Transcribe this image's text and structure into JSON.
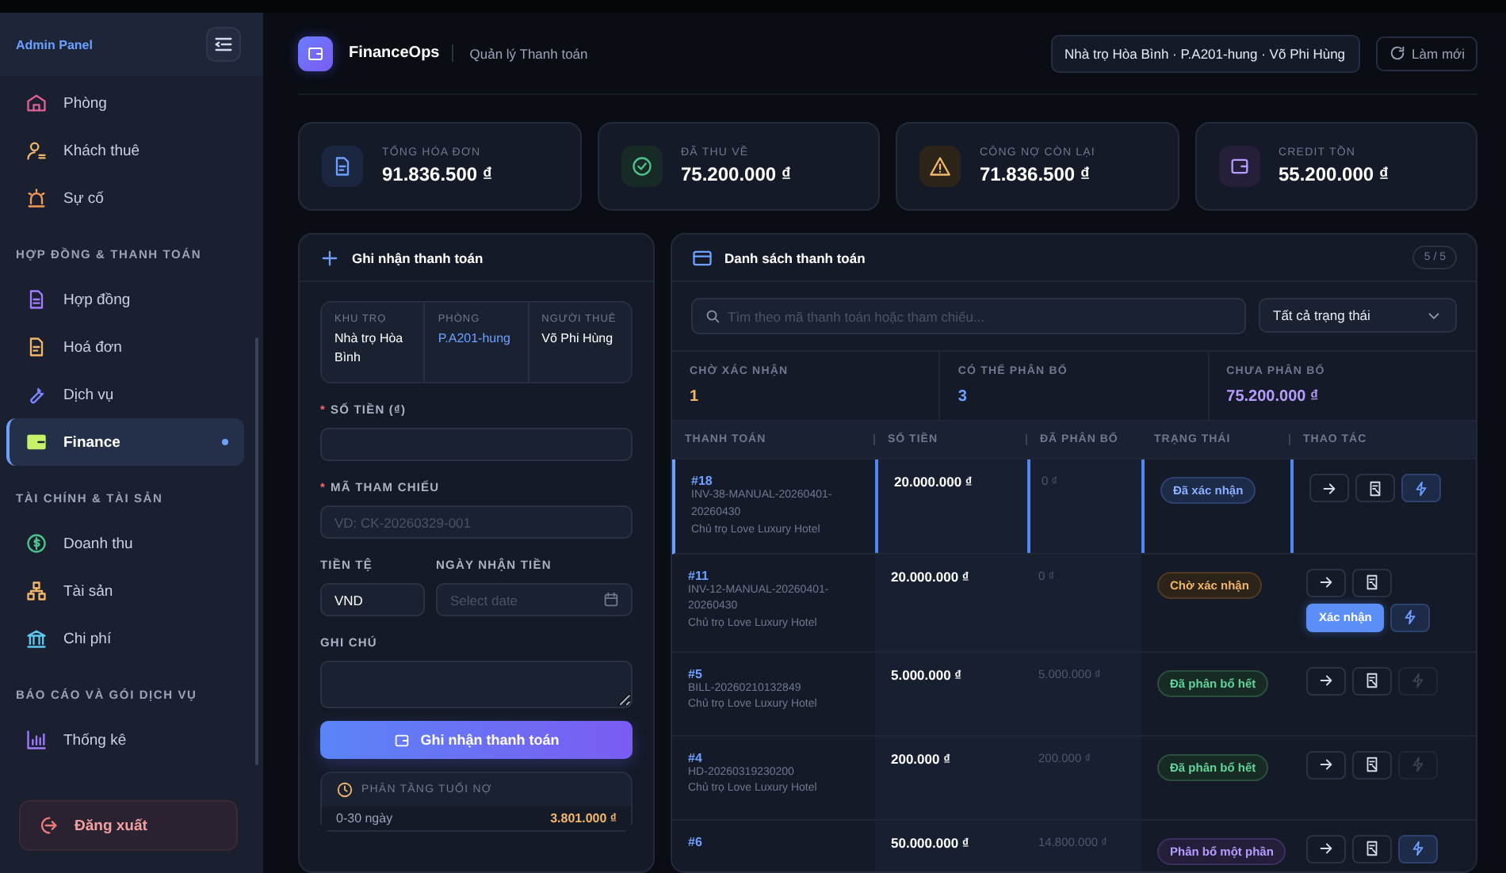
{
  "sidebar": {
    "title": "Admin Panel",
    "sections": [
      {
        "items": [
          {
            "label": "Phòng",
            "selected": false
          },
          {
            "label": "Khách thuê",
            "selected": false
          },
          {
            "label": "Sự cố",
            "selected": false
          }
        ]
      },
      {
        "heading": "HỢP ĐỒNG & THANH TOÁN",
        "items": [
          {
            "label": "Hợp đồng",
            "selected": false
          },
          {
            "label": "Hoá đơn",
            "selected": false
          },
          {
            "label": "Dịch vụ",
            "selected": false
          },
          {
            "label": "Finance",
            "selected": true
          }
        ]
      },
      {
        "heading": "TÀI CHÍNH & TÀI SẢN",
        "items": [
          {
            "label": "Doanh thu",
            "selected": false
          },
          {
            "label": "Tài sản",
            "selected": false
          },
          {
            "label": "Chi phí",
            "selected": false
          }
        ]
      },
      {
        "heading": "BÁO CÁO VÀ GÓI DỊCH VỤ",
        "items": [
          {
            "label": "Thống kê",
            "selected": false
          }
        ]
      }
    ],
    "logout": "Đăng xuất"
  },
  "header": {
    "app": "FinanceOps",
    "subtitle": "Quản lý Thanh toán",
    "context": "Nhà trọ Hòa Bình · P.A201-hung · Võ Phi Hùng",
    "refresh": "Làm mới"
  },
  "stats": [
    {
      "label": "TỔNG HÓA ĐƠN",
      "value": "91.836.500 ₫"
    },
    {
      "label": "ĐÃ THU VỀ",
      "value": "75.200.000 ₫"
    },
    {
      "label": "CÔNG NỢ CÒN LẠI",
      "value": "71.836.500 ₫"
    },
    {
      "label": "CREDIT TỒN",
      "value": "55.200.000 ₫"
    }
  ],
  "form": {
    "title": "Ghi nhận thanh toán",
    "info": [
      {
        "label": "KHU TRỌ",
        "value": "Nhà trọ Hòa Bình",
        "link": false
      },
      {
        "label": "PHÒNG",
        "value": "P.A201-hung",
        "link": true
      },
      {
        "label": "NGƯỜI THUÊ",
        "value": "Võ Phi Hùng",
        "link": false
      }
    ],
    "amount": {
      "label": "SỐ TIỀN (₫)",
      "required_mark": "*"
    },
    "reference": {
      "label": "MÃ THAM CHIẾU",
      "required_mark": "*",
      "placeholder": "VD: CK-20260329-001"
    },
    "currency": {
      "label": "TIỀN TỆ",
      "value": "VND"
    },
    "date": {
      "label": "NGÀY NHẬN TIỀN",
      "placeholder": "Select date"
    },
    "note": {
      "label": "GHI CHÚ"
    },
    "submit": "Ghi nhận thanh toán",
    "aging": {
      "title": "PHÂN TẦNG TUỔI NỢ",
      "rows": [
        {
          "label": "0-30 ngày",
          "value": "3.801.000 ₫"
        }
      ]
    }
  },
  "list": {
    "title": "Danh sách thanh toán",
    "count": "5 / 5",
    "search": {
      "placeholder": "Tìm theo mã thanh toán hoặc tham chiếu..."
    },
    "filter": "Tất cả trạng thái",
    "summary": [
      {
        "label": "CHỜ XÁC NHẬN",
        "value": "1",
        "color": "#f2b66a"
      },
      {
        "label": "CÓ THỂ PHÂN BỔ",
        "value": "3",
        "color": "#6ea0ff"
      },
      {
        "label": "CHƯA PHÂN BỔ",
        "value": "75.200.000 ₫",
        "color": "#b69cff"
      }
    ],
    "columns": [
      "THANH TOÁN",
      "SỐ TIỀN",
      "ĐÃ PHÂN BỔ",
      "TRẠNG THÁI",
      "THAO TÁC"
    ],
    "rows": [
      {
        "id": "#18",
        "code": "INV-38-MANUAL-20260401-20260430",
        "owner": "Chủ trọ Love Luxury Hotel",
        "amount": "20.000.000 ₫",
        "allocated": "0 ₫",
        "status": {
          "label": "Đã xác nhận",
          "kind": "confirmed"
        },
        "confirm": null,
        "allocate_enabled": true,
        "selected": true
      },
      {
        "id": "#11",
        "code": "INV-12-MANUAL-20260401-20260430",
        "owner": "Chủ trọ Love Luxury Hotel",
        "amount": "20.000.000 ₫",
        "allocated": "0 ₫",
        "status": {
          "label": "Chờ xác nhận",
          "kind": "pending"
        },
        "confirm": "Xác nhận",
        "allocate_enabled": true,
        "selected": false
      },
      {
        "id": "#5",
        "code": "BILL-20260210132849",
        "owner": "Chủ trọ Love Luxury Hotel",
        "amount": "5.000.000 ₫",
        "allocated": "5.000.000 ₫",
        "status": {
          "label": "Đã phân bổ hết",
          "kind": "allocated"
        },
        "confirm": null,
        "allocate_enabled": false,
        "selected": false
      },
      {
        "id": "#4",
        "code": "HD-20260319230200",
        "owner": "Chủ trọ Love Luxury Hotel",
        "amount": "200.000 ₫",
        "allocated": "200.000 ₫",
        "status": {
          "label": "Đã phân bổ hết",
          "kind": "allocated"
        },
        "confirm": null,
        "allocate_enabled": false,
        "selected": false
      },
      {
        "id": "#6",
        "amount": "50.000.000 ₫",
        "allocated": "14.800.000 ₫",
        "status": {
          "label": "Phân bổ một phần",
          "kind": "partial"
        },
        "confirm": null,
        "allocate_enabled": true,
        "selected": false
      }
    ]
  }
}
